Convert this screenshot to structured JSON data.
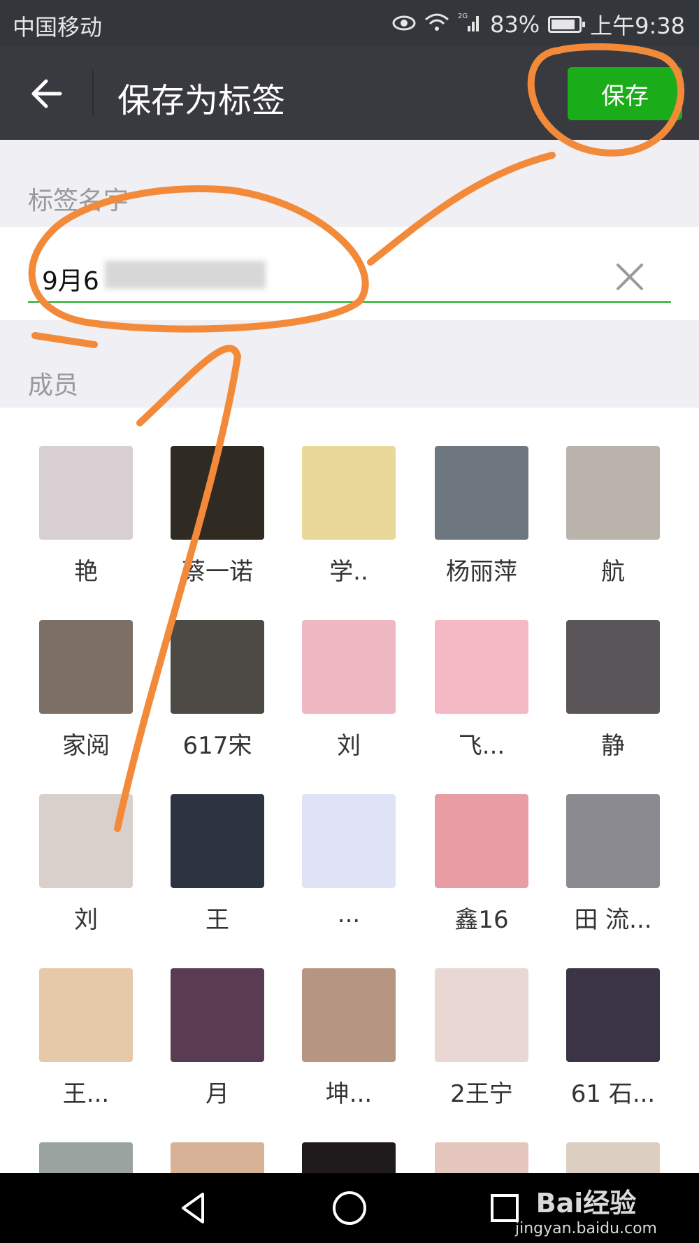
{
  "status_bar": {
    "carrier": "中国移动",
    "network": "2G",
    "battery_percent": "83%",
    "battery_level": 0.83,
    "time": "上午9:38"
  },
  "title_bar": {
    "title": "保存为标签",
    "save_label": "保存"
  },
  "tag_section": {
    "label": "标签名字",
    "value_prefix": "9月6"
  },
  "members_section": {
    "label": "成员",
    "members": [
      {
        "name": "艳",
        "color": "#d8cfd2"
      },
      {
        "name": "蔡一诺",
        "color": "#2f2a22"
      },
      {
        "name": "学..",
        "color": "#e8d89a"
      },
      {
        "name": "杨丽萍",
        "color": "#6e7780"
      },
      {
        "name": "航",
        "color": "#b9b3ac"
      },
      {
        "name": "家阅",
        "color": "#7c7066"
      },
      {
        "name": "617宋",
        "color": "#4d4a45"
      },
      {
        "name": "刘",
        "color": "#efb7c2"
      },
      {
        "name": "飞...",
        "color": "#f4b9c4"
      },
      {
        "name": "静",
        "color": "#5a5559"
      },
      {
        "name": "刘",
        "color": "#d9d0cb"
      },
      {
        "name": "王",
        "color": "#2c3440"
      },
      {
        "name": "...",
        "color": "#dfe3f5"
      },
      {
        "name": "鑫16",
        "color": "#e89da4"
      },
      {
        "name": "田 流...",
        "color": "#8a8a90"
      },
      {
        "name": "王...",
        "color": "#e6c9a8"
      },
      {
        "name": "月",
        "color": "#5a3c52"
      },
      {
        "name": "坤...",
        "color": "#b69683"
      },
      {
        "name": "2王宁",
        "color": "#e9d7d3"
      },
      {
        "name": "61 石...",
        "color": "#3a3444"
      },
      {
        "name": "",
        "color": "#9aa3a0"
      },
      {
        "name": "",
        "color": "#d7b297"
      },
      {
        "name": "",
        "color": "#1f1a1c"
      },
      {
        "name": "",
        "color": "#e6c7bf"
      },
      {
        "name": "",
        "color": "#dccfc2"
      }
    ]
  },
  "nav_bar": {
    "back_icon": "triangle-back-icon",
    "home_icon": "circle-home-icon",
    "recents_icon": "square-recents-icon"
  },
  "watermark": {
    "brand": "Bai经验",
    "url": "jingyan.baidu.com"
  },
  "colors": {
    "accent": "#1aad19",
    "titlebar": "#393a3f",
    "annotation": "#f28a3a"
  }
}
